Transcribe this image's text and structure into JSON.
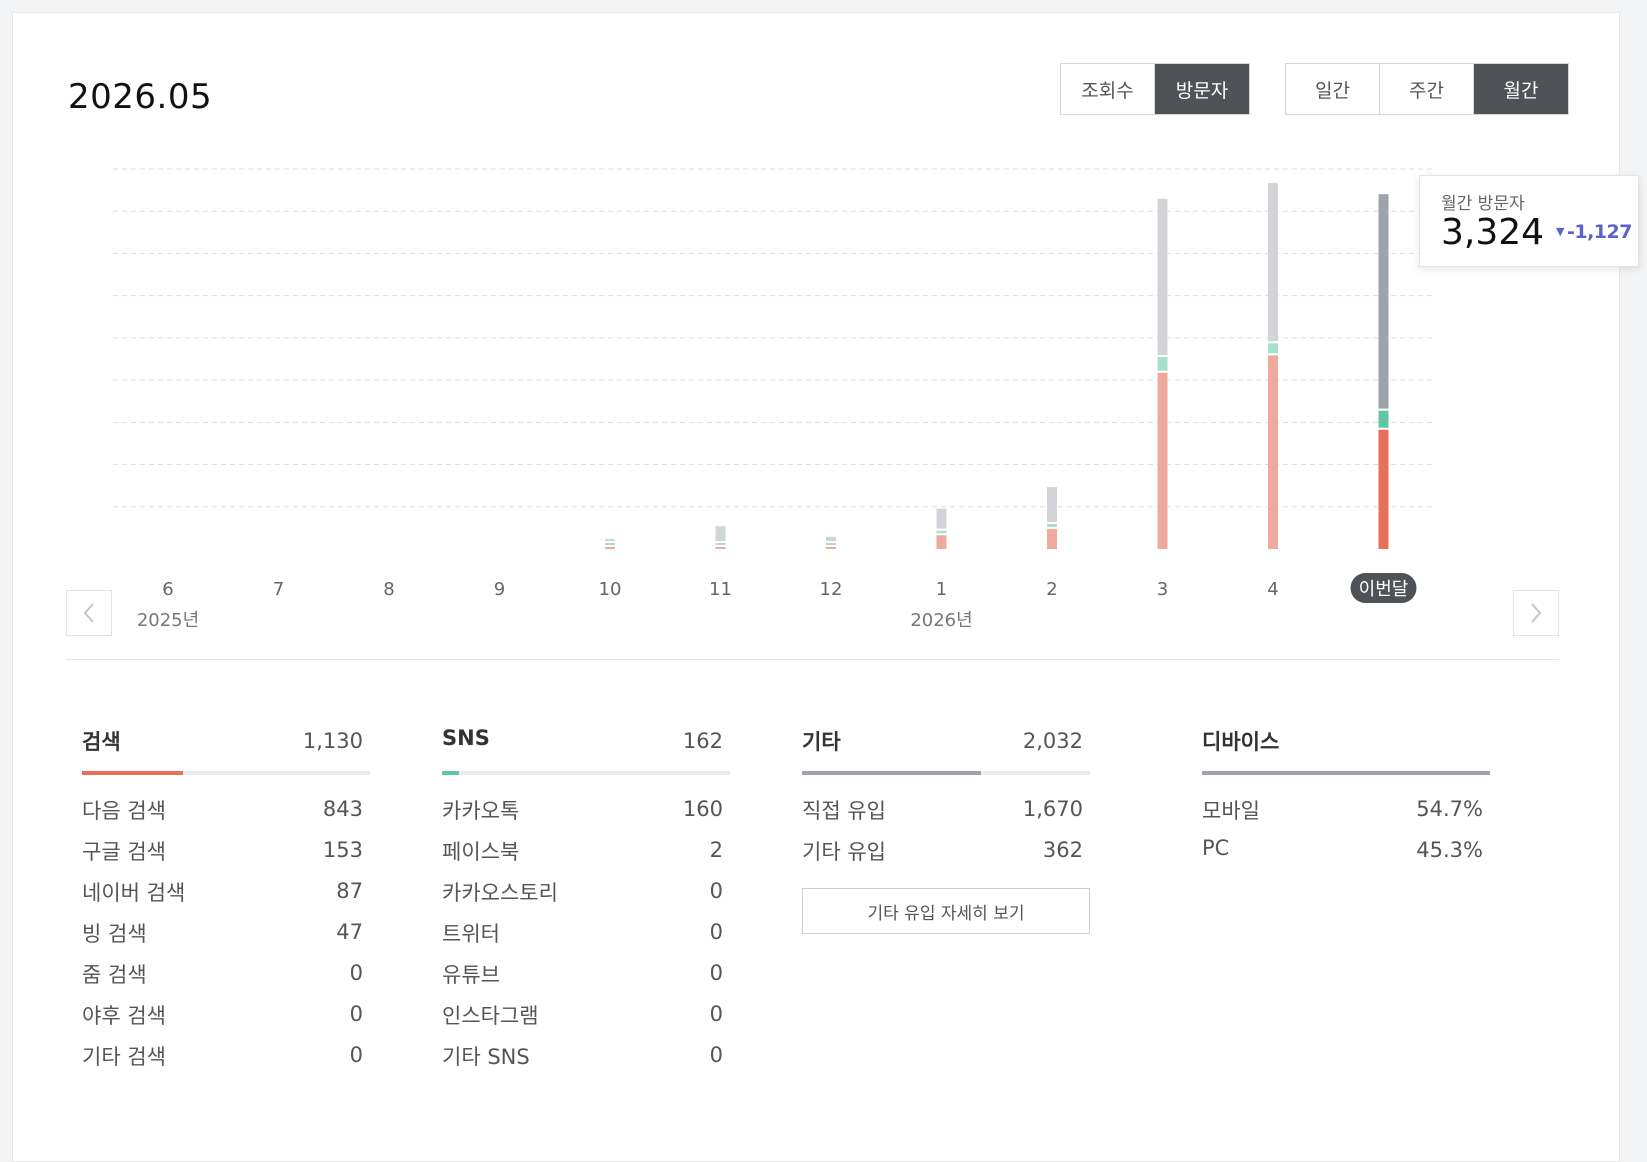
{
  "header": {
    "period_title": "2026.05"
  },
  "metric_toggle": {
    "options": [
      {
        "label": "조회수",
        "active": false
      },
      {
        "label": "방문자",
        "active": true
      }
    ]
  },
  "period_toggle": {
    "options": [
      {
        "label": "일간",
        "active": false
      },
      {
        "label": "주간",
        "active": false
      },
      {
        "label": "월간",
        "active": true
      }
    ]
  },
  "colors": {
    "search": "#e8705a",
    "sns": "#5fc7a5",
    "other": "#9fa4ab",
    "badge": "#4f5256",
    "change_down": "#5b63c9"
  },
  "tooltip": {
    "label": "월간 방문자",
    "value": "3,324",
    "change": "-1,127"
  },
  "chart_data": {
    "type": "bar",
    "stacked": true,
    "categories": [
      "6",
      "7",
      "8",
      "9",
      "10",
      "11",
      "12",
      "1",
      "2",
      "3",
      "4",
      "이번달"
    ],
    "year_labels": [
      {
        "index": 0,
        "label": "2025년"
      },
      {
        "index": 7,
        "label": "2026년"
      }
    ],
    "series": [
      {
        "key": "search",
        "values": [
          0,
          0,
          0,
          0,
          10,
          18,
          10,
          130,
          190,
          1670,
          1835,
          1130
        ]
      },
      {
        "key": "sns",
        "values": [
          0,
          0,
          0,
          0,
          10,
          14,
          10,
          25,
          28,
          130,
          95,
          162
        ]
      },
      {
        "key": "other",
        "values": [
          0,
          0,
          0,
          0,
          10,
          140,
          40,
          190,
          330,
          1480,
          1500,
          2032
        ]
      }
    ],
    "highlight_index": 11,
    "ylim": [
      0,
      3600
    ],
    "grid": true,
    "gridlines": 9,
    "legend": "none"
  },
  "nav": {
    "prev_icon": "chevron-left-icon",
    "next_icon": "chevron-right-icon"
  },
  "panels": {
    "search": {
      "title": "검색",
      "total": "1,130",
      "bar_fraction": 0.35,
      "rows": [
        {
          "label": "다음 검색",
          "value": "843"
        },
        {
          "label": "구글 검색",
          "value": "153"
        },
        {
          "label": "네이버 검색",
          "value": "87"
        },
        {
          "label": "빙 검색",
          "value": "47"
        },
        {
          "label": "줌 검색",
          "value": "0"
        },
        {
          "label": "야후 검색",
          "value": "0"
        },
        {
          "label": "기타 검색",
          "value": "0"
        }
      ]
    },
    "sns": {
      "title": "SNS",
      "total": "162",
      "bar_fraction": 0.06,
      "rows": [
        {
          "label": "카카오톡",
          "value": "160"
        },
        {
          "label": "페이스북",
          "value": "2"
        },
        {
          "label": "카카오스토리",
          "value": "0"
        },
        {
          "label": "트위터",
          "value": "0"
        },
        {
          "label": "유튜브",
          "value": "0"
        },
        {
          "label": "인스타그램",
          "value": "0"
        },
        {
          "label": "기타 SNS",
          "value": "0"
        }
      ]
    },
    "other": {
      "title": "기타",
      "total": "2,032",
      "bar_fraction": 0.62,
      "rows": [
        {
          "label": "직접 유입",
          "value": "1,670"
        },
        {
          "label": "기타 유입",
          "value": "362"
        }
      ],
      "detail_button": "기타 유입 자세히 보기"
    },
    "device": {
      "title": "디바이스",
      "bar_fraction": 1.0,
      "rows": [
        {
          "label": "모바일",
          "value": "54.7%"
        },
        {
          "label": "PC",
          "value": "45.3%"
        }
      ]
    }
  }
}
